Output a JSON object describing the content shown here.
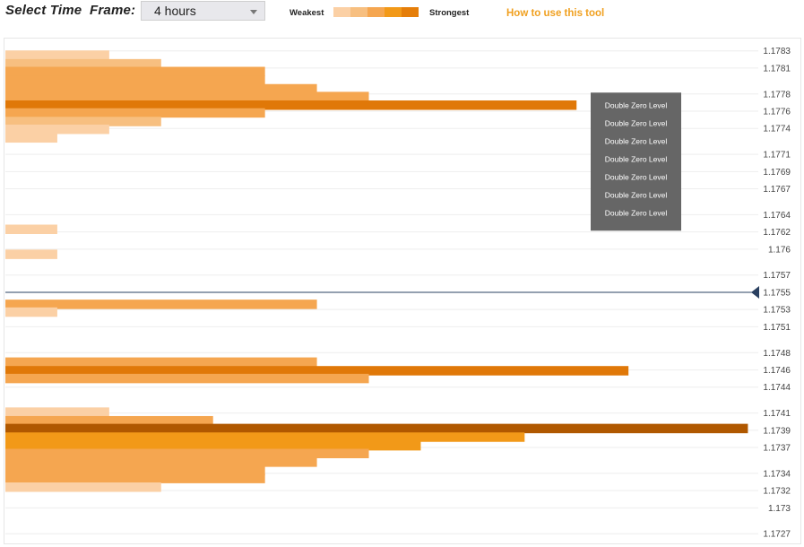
{
  "toolbar": {
    "timeframe_label": "Select Time  Frame:",
    "timeframe_value": "4 hours",
    "legend_weakest": "Weakest",
    "legend_strongest": "Strongest",
    "help_link": "How to use this tool"
  },
  "colors": {
    "strength_scale": [
      "#fbd0a5",
      "#f7bf80",
      "#f5a650",
      "#f29918",
      "#e57e0a"
    ],
    "strength_levels": [
      "#fbd0a5",
      "#f7bf80",
      "#f5a650",
      "#f29918",
      "#e07808",
      "#b05800"
    ],
    "current_price_line": "#2a4060",
    "grid": "#eeeeee",
    "tooltip_bg": "#666666",
    "tooltip_text": "#ffffff",
    "axis_label": "#444444"
  },
  "chart_data": {
    "type": "bar",
    "orientation": "horizontal",
    "y_ticks": [
      "1.1783",
      "1.1781",
      "1.1778",
      "1.1776",
      "1.1774",
      "1.1771",
      "1.1769",
      "1.1767",
      "1.1764",
      "1.1762",
      "1.176",
      "1.1757",
      "1.1755",
      "1.1753",
      "1.1751",
      "1.1748",
      "1.1746",
      "1.1744",
      "1.1741",
      "1.1739",
      "1.1737",
      "1.1734",
      "1.1732",
      "1.173",
      "1.1727"
    ],
    "ylim": [
      1.17265,
      1.17838
    ],
    "xlim": [
      0,
      14.5
    ],
    "current_price": 1.1755,
    "bars": [
      {
        "price": 1.17825,
        "value": 2,
        "strength": 0
      },
      {
        "price": 1.17815,
        "value": 3,
        "strength": 1
      },
      {
        "price": 1.17806,
        "value": 5,
        "strength": 2
      },
      {
        "price": 1.17796,
        "value": 5,
        "strength": 2
      },
      {
        "price": 1.17786,
        "value": 6,
        "strength": 2
      },
      {
        "price": 1.17777,
        "value": 7,
        "strength": 2
      },
      {
        "price": 1.17767,
        "value": 11,
        "strength": 4
      },
      {
        "price": 1.17758,
        "value": 5,
        "strength": 2
      },
      {
        "price": 1.17748,
        "value": 3,
        "strength": 1
      },
      {
        "price": 1.17739,
        "value": 2,
        "strength": 0
      },
      {
        "price": 1.17729,
        "value": 1,
        "strength": 0
      },
      {
        "price": 1.17623,
        "value": 1,
        "strength": 0
      },
      {
        "price": 1.17594,
        "value": 1,
        "strength": 0
      },
      {
        "price": 1.17536,
        "value": 6,
        "strength": 2
      },
      {
        "price": 1.17527,
        "value": 1,
        "strength": 0
      },
      {
        "price": 1.17469,
        "value": 6,
        "strength": 2
      },
      {
        "price": 1.17459,
        "value": 12,
        "strength": 4
      },
      {
        "price": 1.1745,
        "value": 7,
        "strength": 2
      },
      {
        "price": 1.17411,
        "value": 2,
        "strength": 0
      },
      {
        "price": 1.17401,
        "value": 4,
        "strength": 2
      },
      {
        "price": 1.17392,
        "value": 14.3,
        "strength": 5
      },
      {
        "price": 1.17382,
        "value": 10,
        "strength": 3
      },
      {
        "price": 1.17372,
        "value": 8,
        "strength": 3
      },
      {
        "price": 1.17363,
        "value": 7,
        "strength": 2
      },
      {
        "price": 1.17353,
        "value": 6,
        "strength": 2
      },
      {
        "price": 1.17343,
        "value": 5,
        "strength": 2
      },
      {
        "price": 1.17334,
        "value": 5,
        "strength": 2
      },
      {
        "price": 1.17324,
        "value": 3,
        "strength": 0
      }
    ],
    "tooltip": {
      "anchor_price": 1.17767,
      "lines": [
        "Double Zero Level",
        "Double Zero Level",
        "Double Zero Level",
        "Double Zero Level",
        "Double Zero Level",
        "Double Zero Level",
        "Double Zero Level"
      ]
    }
  }
}
